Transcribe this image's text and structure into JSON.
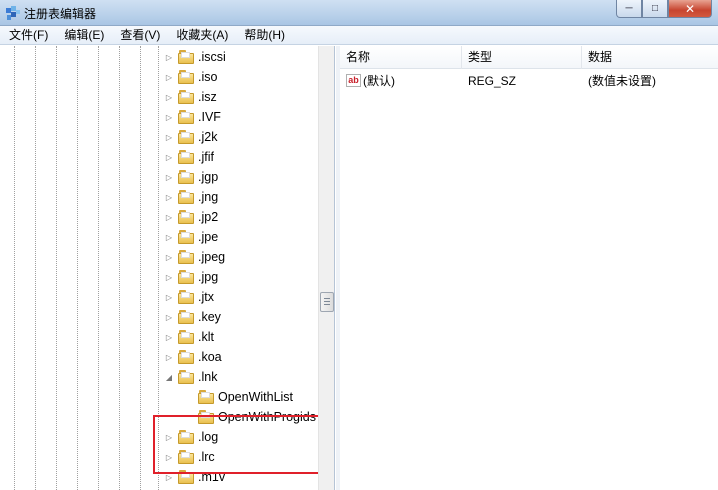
{
  "window": {
    "title": "注册表编辑器",
    "minimize": "─",
    "maximize": "□",
    "close": "✕"
  },
  "menu": [
    "文件(F)",
    "编辑(E)",
    "查看(V)",
    "收藏夹(A)",
    "帮助(H)"
  ],
  "tree": {
    "nodes_before": [
      ".iscsi",
      ".iso",
      ".isz",
      ".IVF",
      ".j2k",
      ".jfif",
      ".jgp",
      ".jng",
      ".jp2",
      ".jpe",
      ".jpeg",
      ".jpg",
      ".jtx",
      ".key",
      ".klt",
      ".koa"
    ],
    "expanded_node": ".lnk",
    "expanded_children": [
      "OpenWithList",
      "OpenWithProgids"
    ],
    "nodes_after": [
      ".log",
      ".lrc",
      ".m1v"
    ]
  },
  "list": {
    "columns": [
      "名称",
      "类型",
      "数据"
    ],
    "rows": [
      {
        "name": "(默认)",
        "type": "REG_SZ",
        "data": "(数值未设置)"
      }
    ]
  }
}
